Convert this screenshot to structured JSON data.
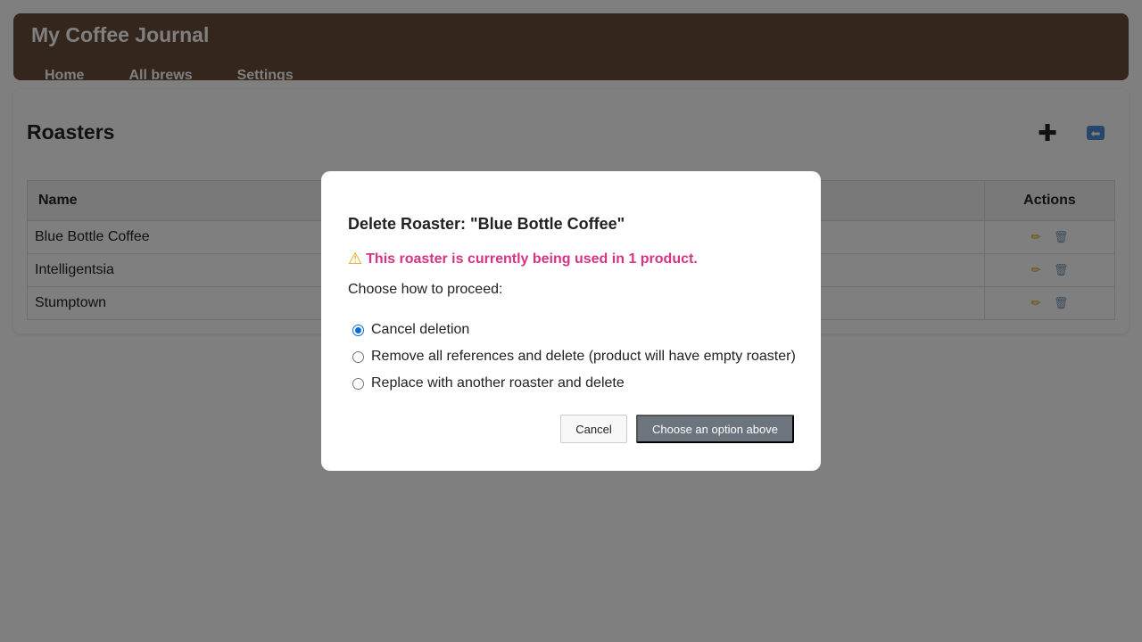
{
  "app": {
    "title": "My Coffee Journal"
  },
  "nav": [
    {
      "label": "Home"
    },
    {
      "label": "All brews"
    },
    {
      "label": "Settings"
    }
  ],
  "roasters_panel": {
    "title": "Roasters",
    "add_icon": "plus-icon",
    "back_icon": "back-arrow-icon",
    "columns": {
      "name": "Name",
      "actions": "Actions"
    },
    "rows": [
      {
        "name": "Blue Bottle Coffee"
      },
      {
        "name": "Intelligentsia"
      },
      {
        "name": "Stumptown"
      }
    ]
  },
  "modal": {
    "title": "Delete Roaster: \"Blue Bottle Coffee\"",
    "warning": "This roaster is currently being used in 1 product.",
    "warning_color": "#d63384",
    "prompt": "Choose how to proceed:",
    "options": [
      {
        "label": "Cancel deletion",
        "selected": true
      },
      {
        "label": "Remove all references and delete (product will have empty roaster)",
        "selected": false
      },
      {
        "label": "Replace with another roaster and delete",
        "selected": false
      }
    ],
    "cancel_label": "Cancel",
    "confirm_label": "Choose an option above"
  },
  "colors": {
    "header_bg": "#6b4c3b",
    "confirm_bg": "#6c757d",
    "radio_accent": "#0a6cdb"
  }
}
